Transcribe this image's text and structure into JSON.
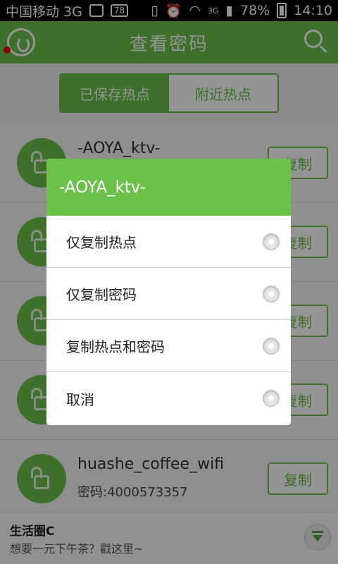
{
  "status_bar": {
    "carrier": "中国移动 3G",
    "notification_count": "78",
    "network_tag": "3G",
    "battery": "78%",
    "time": "14:10"
  },
  "header": {
    "title": "查看密码"
  },
  "tabs": [
    {
      "label": "已保存热点",
      "active": true
    },
    {
      "label": "附近热点",
      "active": false
    }
  ],
  "list": {
    "copy_label": "复制",
    "items": [
      {
        "name": "-AOYA_ktv-",
        "password": ""
      },
      {
        "name": "",
        "password": ""
      },
      {
        "name": "",
        "password": ""
      },
      {
        "name": "",
        "password": ""
      },
      {
        "name": "huashe_coffee_wifi",
        "password": "密码:4000573357"
      }
    ]
  },
  "ad": {
    "title": "生活圈C",
    "text": "想要一元下午茶？戳这里~"
  },
  "dialog": {
    "title": "-AOYA_ktv-",
    "options": [
      {
        "label": "仅复制热点"
      },
      {
        "label": "仅复制密码"
      },
      {
        "label": "复制热点和密码"
      },
      {
        "label": "取消"
      }
    ]
  },
  "colors": {
    "accent": "#6cc14a"
  }
}
